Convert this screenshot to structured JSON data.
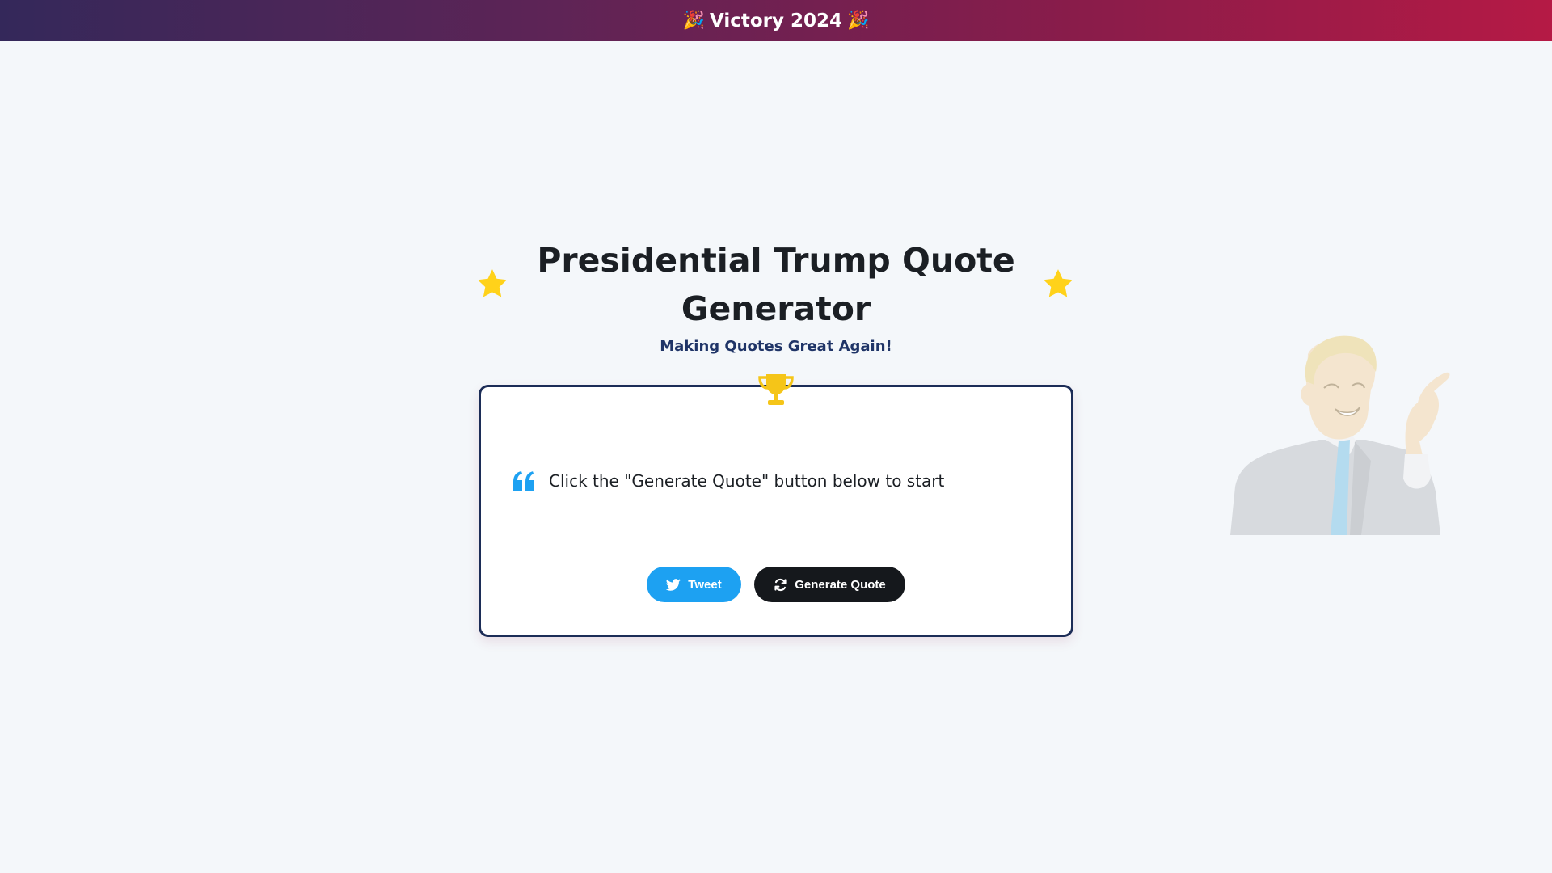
{
  "banner": {
    "party_icon": "party-popper-icon",
    "text": "Victory 2024",
    "background": [
      "#34285a",
      "#b51a45"
    ]
  },
  "header": {
    "title": "Presidential Trump Quote Generator",
    "subtitle": "Making Quotes Great Again!",
    "decor_icon": "star-icon",
    "decor_color": "#ffd21a"
  },
  "quote_card": {
    "top_icon": "trophy-icon",
    "quote_icon": "quote-left-icon",
    "quote_text": "Click the \"Generate Quote\" button below to start",
    "border_color": "#1c2d57"
  },
  "actions": {
    "tweet_label": "Tweet",
    "tweet_icon": "twitter-icon",
    "tweet_color": "#1da1f2",
    "generate_label": "Generate Quote",
    "generate_icon": "refresh-icon",
    "generate_color": "#15181c"
  },
  "illustration": {
    "name": "trump-cartoon-image"
  }
}
